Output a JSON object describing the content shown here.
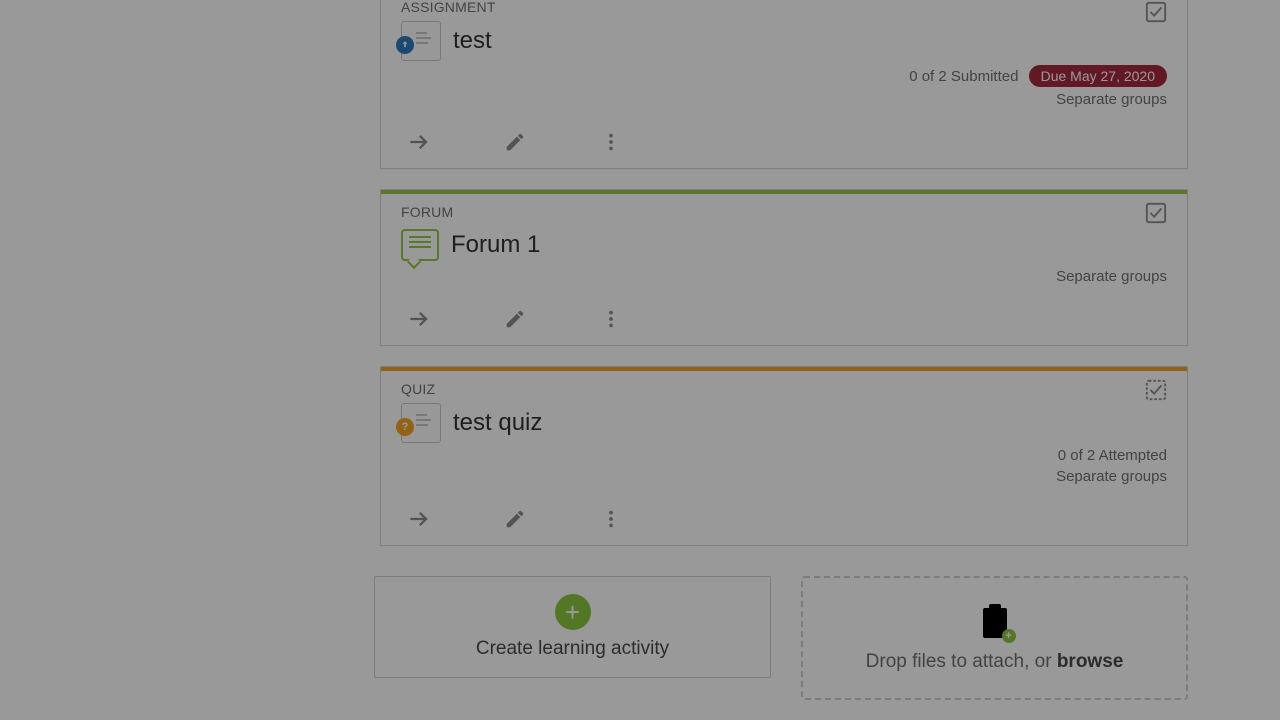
{
  "cards": [
    {
      "type_label": "ASSIGNMENT",
      "title": "test",
      "submitted": "0 of 2 Submitted",
      "due": "Due May 27, 2020",
      "groups": "Separate groups"
    },
    {
      "type_label": "FORUM",
      "title": "Forum 1",
      "groups": "Separate groups"
    },
    {
      "type_label": "QUIZ",
      "title": "test quiz",
      "attempted": "0 of 2 Attempted",
      "groups": "Separate groups"
    }
  ],
  "create_activity": "Create learning activity",
  "dropzone": {
    "prefix": "Drop files to attach, or ",
    "action": "browse"
  }
}
